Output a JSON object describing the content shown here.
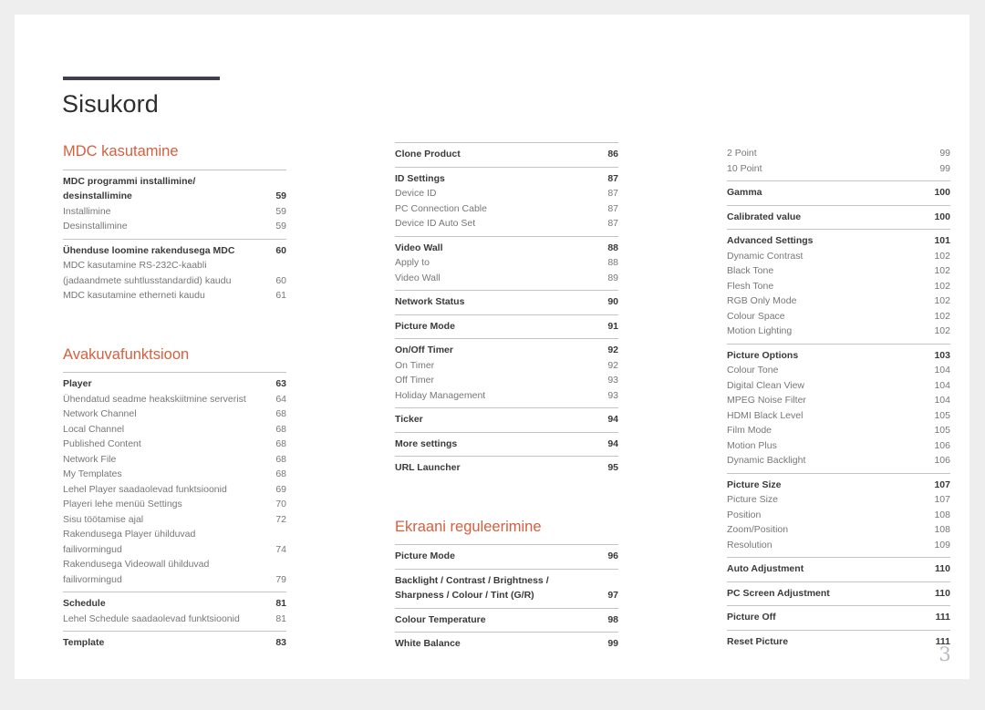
{
  "document": {
    "title": "Sisukord",
    "folio": "3",
    "accent_color": "#d4603f",
    "rule_color": "#3f3f52",
    "page_background": "#ffffff",
    "canvas_background": "#eeeeee"
  },
  "columns": [
    {
      "name": "column-1",
      "blocks": [
        {
          "type": "heading",
          "text": "MDC kasutamine",
          "gap_top": false
        },
        {
          "type": "group",
          "entries": [
            {
              "label": "MDC programmi installimine/\ndesinstallimine",
              "page": "59",
              "level": 1,
              "wrap": true
            },
            {
              "label": "Installimine",
              "page": "59",
              "level": 2,
              "wrap": false
            },
            {
              "label": "Desinstallimine",
              "page": "59",
              "level": 2,
              "wrap": false
            }
          ]
        },
        {
          "type": "group",
          "entries": [
            {
              "label": "Ühenduse loomine rakendusega MDC",
              "page": "60",
              "level": 1,
              "wrap": false
            },
            {
              "label": "MDC kasutamine RS-232C-kaabli\n(jadaandmete suhtlusstandardid) kaudu",
              "page": "60",
              "level": 2,
              "wrap": true
            },
            {
              "label": "MDC kasutamine etherneti kaudu",
              "page": "61",
              "level": 2,
              "wrap": false
            }
          ]
        },
        {
          "type": "heading",
          "text": "Avakuvafunktsioon",
          "gap_top": true
        },
        {
          "type": "group",
          "entries": [
            {
              "label": "Player",
              "page": "63",
              "level": 1,
              "wrap": false
            },
            {
              "label": "Ühendatud seadme heakskiitmine serverist",
              "page": "64",
              "level": 2,
              "wrap": false
            },
            {
              "label": "Network Channel",
              "page": "68",
              "level": 2,
              "wrap": false
            },
            {
              "label": "Local Channel",
              "page": "68",
              "level": 2,
              "wrap": false
            },
            {
              "label": "Published Content",
              "page": "68",
              "level": 2,
              "wrap": false
            },
            {
              "label": "Network File",
              "page": "68",
              "level": 2,
              "wrap": false
            },
            {
              "label": "My Templates",
              "page": "68",
              "level": 2,
              "wrap": false
            },
            {
              "label": "Lehel Player saadaolevad funktsioonid",
              "page": "69",
              "level": 2,
              "wrap": false
            },
            {
              "label": "Playeri lehe menüü Settings",
              "page": "70",
              "level": 2,
              "wrap": false
            },
            {
              "label": "Sisu töötamise ajal",
              "page": "72",
              "level": 2,
              "wrap": false
            },
            {
              "label": "Rakendusega Player ühilduvad\nfailivormingud",
              "page": "74",
              "level": 2,
              "wrap": true
            },
            {
              "label": "Rakendusega Videowall ühilduvad\nfailivormingud",
              "page": "79",
              "level": 2,
              "wrap": true
            }
          ]
        },
        {
          "type": "group",
          "entries": [
            {
              "label": "Schedule",
              "page": "81",
              "level": 1,
              "wrap": false
            },
            {
              "label": "Lehel Schedule saadaolevad funktsioonid",
              "page": "81",
              "level": 2,
              "wrap": false
            }
          ]
        },
        {
          "type": "group",
          "entries": [
            {
              "label": "Template",
              "page": "83",
              "level": 1,
              "wrap": false
            }
          ]
        }
      ]
    },
    {
      "name": "column-2",
      "blocks": [
        {
          "type": "group",
          "entries": [
            {
              "label": "Clone Product",
              "page": "86",
              "level": 1,
              "wrap": false
            }
          ]
        },
        {
          "type": "group",
          "entries": [
            {
              "label": "ID Settings",
              "page": "87",
              "level": 1,
              "wrap": false
            },
            {
              "label": "Device ID",
              "page": "87",
              "level": 2,
              "wrap": false
            },
            {
              "label": "PC Connection Cable",
              "page": "87",
              "level": 2,
              "wrap": false
            },
            {
              "label": "Device ID Auto Set",
              "page": "87",
              "level": 2,
              "wrap": false
            }
          ]
        },
        {
          "type": "group",
          "entries": [
            {
              "label": "Video Wall",
              "page": "88",
              "level": 1,
              "wrap": false
            },
            {
              "label": "Apply to",
              "page": "88",
              "level": 2,
              "wrap": false
            },
            {
              "label": "Video Wall",
              "page": "89",
              "level": 2,
              "wrap": false
            }
          ]
        },
        {
          "type": "group",
          "entries": [
            {
              "label": "Network Status",
              "page": "90",
              "level": 1,
              "wrap": false
            }
          ]
        },
        {
          "type": "group",
          "entries": [
            {
              "label": "Picture Mode",
              "page": "91",
              "level": 1,
              "wrap": false
            }
          ]
        },
        {
          "type": "group",
          "entries": [
            {
              "label": "On/Off Timer",
              "page": "92",
              "level": 1,
              "wrap": false
            },
            {
              "label": "On Timer",
              "page": "92",
              "level": 2,
              "wrap": false
            },
            {
              "label": "Off Timer",
              "page": "93",
              "level": 2,
              "wrap": false
            },
            {
              "label": "Holiday Management",
              "page": "93",
              "level": 2,
              "wrap": false
            }
          ]
        },
        {
          "type": "group",
          "entries": [
            {
              "label": "Ticker",
              "page": "94",
              "level": 1,
              "wrap": false
            }
          ]
        },
        {
          "type": "group",
          "entries": [
            {
              "label": "More settings",
              "page": "94",
              "level": 1,
              "wrap": false
            }
          ]
        },
        {
          "type": "group",
          "entries": [
            {
              "label": "URL Launcher",
              "page": "95",
              "level": 1,
              "wrap": false
            }
          ]
        },
        {
          "type": "heading",
          "text": "Ekraani reguleerimine",
          "gap_top": true
        },
        {
          "type": "group",
          "entries": [
            {
              "label": "Picture Mode",
              "page": "96",
              "level": 1,
              "wrap": false
            }
          ]
        },
        {
          "type": "group",
          "entries": [
            {
              "label": "Backlight / Contrast / Brightness /\nSharpness / Colour / Tint (G/R)",
              "page": "97",
              "level": 1,
              "wrap": true
            }
          ]
        },
        {
          "type": "group",
          "entries": [
            {
              "label": "Colour Temperature",
              "page": "98",
              "level": 1,
              "wrap": false
            }
          ]
        },
        {
          "type": "group",
          "entries": [
            {
              "label": "White Balance",
              "page": "99",
              "level": 1,
              "wrap": false
            }
          ]
        }
      ]
    },
    {
      "name": "column-3",
      "blocks": [
        {
          "type": "group",
          "no_rule": true,
          "entries": [
            {
              "label": "2 Point",
              "page": "99",
              "level": 2,
              "wrap": false
            },
            {
              "label": "10 Point",
              "page": "99",
              "level": 2,
              "wrap": false
            }
          ]
        },
        {
          "type": "group",
          "entries": [
            {
              "label": "Gamma",
              "page": "100",
              "level": 1,
              "wrap": false
            }
          ]
        },
        {
          "type": "group",
          "entries": [
            {
              "label": "Calibrated value",
              "page": "100",
              "level": 1,
              "wrap": false
            }
          ]
        },
        {
          "type": "group",
          "entries": [
            {
              "label": "Advanced Settings",
              "page": "101",
              "level": 1,
              "wrap": false
            },
            {
              "label": "Dynamic Contrast",
              "page": "102",
              "level": 2,
              "wrap": false
            },
            {
              "label": "Black Tone",
              "page": "102",
              "level": 2,
              "wrap": false
            },
            {
              "label": "Flesh Tone",
              "page": "102",
              "level": 2,
              "wrap": false
            },
            {
              "label": "RGB Only Mode",
              "page": "102",
              "level": 2,
              "wrap": false
            },
            {
              "label": "Colour Space",
              "page": "102",
              "level": 2,
              "wrap": false
            },
            {
              "label": "Motion Lighting",
              "page": "102",
              "level": 2,
              "wrap": false
            }
          ]
        },
        {
          "type": "group",
          "entries": [
            {
              "label": "Picture Options",
              "page": "103",
              "level": 1,
              "wrap": false
            },
            {
              "label": "Colour Tone",
              "page": "104",
              "level": 2,
              "wrap": false
            },
            {
              "label": "Digital Clean View",
              "page": "104",
              "level": 2,
              "wrap": false
            },
            {
              "label": "MPEG Noise Filter",
              "page": "104",
              "level": 2,
              "wrap": false
            },
            {
              "label": "HDMI Black Level",
              "page": "105",
              "level": 2,
              "wrap": false
            },
            {
              "label": "Film Mode",
              "page": "105",
              "level": 2,
              "wrap": false
            },
            {
              "label": "Motion Plus",
              "page": "106",
              "level": 2,
              "wrap": false
            },
            {
              "label": "Dynamic Backlight",
              "page": "106",
              "level": 2,
              "wrap": false
            }
          ]
        },
        {
          "type": "group",
          "entries": [
            {
              "label": "Picture Size",
              "page": "107",
              "level": 1,
              "wrap": false
            },
            {
              "label": "Picture Size",
              "page": "107",
              "level": 2,
              "wrap": false
            },
            {
              "label": "Position",
              "page": "108",
              "level": 2,
              "wrap": false
            },
            {
              "label": "Zoom/Position",
              "page": "108",
              "level": 2,
              "wrap": false
            },
            {
              "label": "Resolution",
              "page": "109",
              "level": 2,
              "wrap": false
            }
          ]
        },
        {
          "type": "group",
          "entries": [
            {
              "label": "Auto Adjustment",
              "page": "110",
              "level": 1,
              "wrap": false
            }
          ]
        },
        {
          "type": "group",
          "entries": [
            {
              "label": "PC Screen Adjustment",
              "page": "110",
              "level": 1,
              "wrap": false
            }
          ]
        },
        {
          "type": "group",
          "entries": [
            {
              "label": "Picture Off",
              "page": "111",
              "level": 1,
              "wrap": false
            }
          ]
        },
        {
          "type": "group",
          "entries": [
            {
              "label": "Reset Picture",
              "page": "111",
              "level": 1,
              "wrap": false
            }
          ]
        }
      ]
    }
  ]
}
